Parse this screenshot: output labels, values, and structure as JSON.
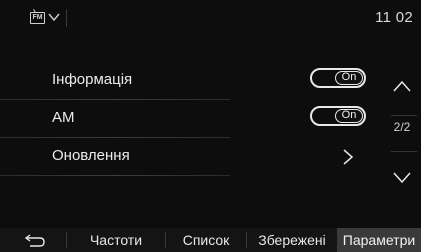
{
  "status": {
    "source_badge": "FM",
    "time": "11 02"
  },
  "settings": {
    "rows": [
      {
        "label": "Інформація",
        "toggle_label": "On",
        "toggle_on": true
      },
      {
        "label": "AM",
        "toggle_label": "On",
        "toggle_on": true
      },
      {
        "label": "Оновлення",
        "control": "chevron-right-icon"
      }
    ]
  },
  "pager": {
    "indicator": "2/2"
  },
  "tabs": [
    {
      "label": "Частоти",
      "active": false
    },
    {
      "label": "Список",
      "active": false
    },
    {
      "label": "Збережені",
      "active": false
    },
    {
      "label": "Параметри",
      "active": true
    }
  ],
  "icons": [
    "fm-source-icon",
    "chevron-down-icon",
    "chevron-up-icon",
    "chevron-right-icon",
    "back-icon"
  ],
  "colors": {
    "background": "#0d0d0d",
    "active_tab": "#3a3a3a",
    "text": "#e6e6e6"
  }
}
